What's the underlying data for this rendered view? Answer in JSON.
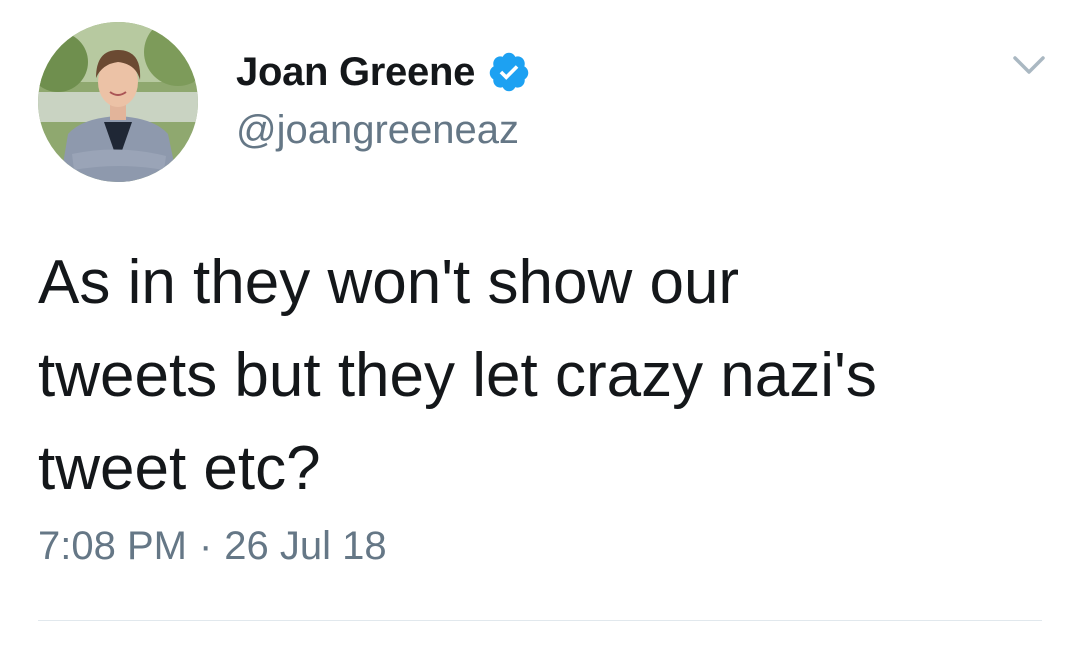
{
  "tweet": {
    "display_name": "Joan Greene",
    "handle": "@joangreeneaz",
    "text": "As in they won't show our\ntweets but they let crazy nazi's\ntweet etc?",
    "time": "7:08 PM",
    "separator": "·",
    "date": "26 Jul 18"
  },
  "icons": {
    "verified": "verified-badge-icon",
    "menu": "chevron-down-icon"
  },
  "colors": {
    "verified_blue": "#1da1f2",
    "secondary_text": "#657786",
    "primary_text": "#14171a"
  }
}
